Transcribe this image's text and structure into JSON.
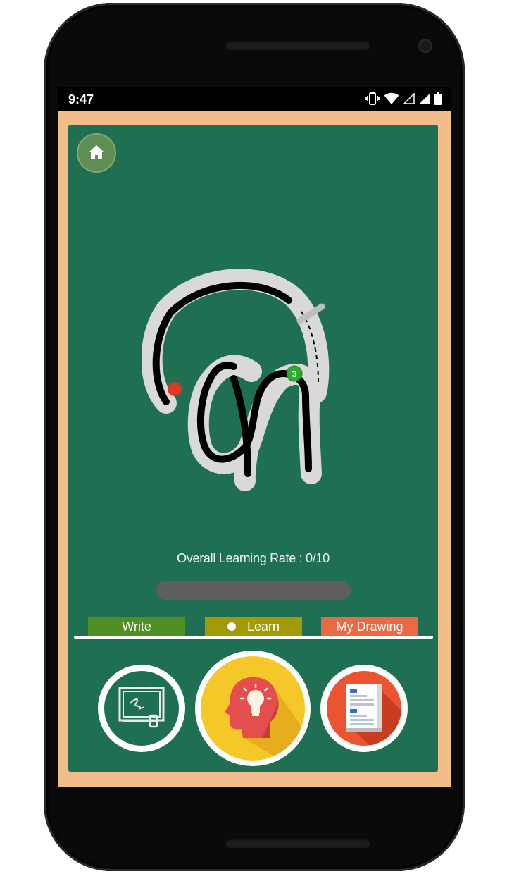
{
  "status_bar": {
    "time": "9:47",
    "icons": [
      "vibrate-icon",
      "wifi-icon",
      "signal-empty-icon",
      "signal-icon",
      "battery-icon"
    ]
  },
  "home_button": {
    "icon": "home-icon"
  },
  "tracing": {
    "stroke_markers": [
      "1",
      "3"
    ],
    "colors": {
      "board": "#1f7053",
      "guide": "#d9d9d9",
      "stroke": "#000000",
      "start_marker": "#d83a26",
      "current_marker": "#2eaa2e"
    }
  },
  "learning": {
    "rate_text": "Overall Learning Rate : 0/10",
    "progress": 0
  },
  "tabs": {
    "write": "Write",
    "learn": "Learn",
    "my_drawing": "My Drawing"
  },
  "mode_buttons": {
    "write_icon": "chalkboard-writing-icon",
    "learn_icon": "head-lightbulb-icon",
    "drawing_icon": "document-list-icon"
  },
  "colors": {
    "frame": "#f0bd8b",
    "write_tab": "#4f8f23",
    "learn_tab": "#a29a06",
    "drawing_tab": "#ea6a46"
  }
}
